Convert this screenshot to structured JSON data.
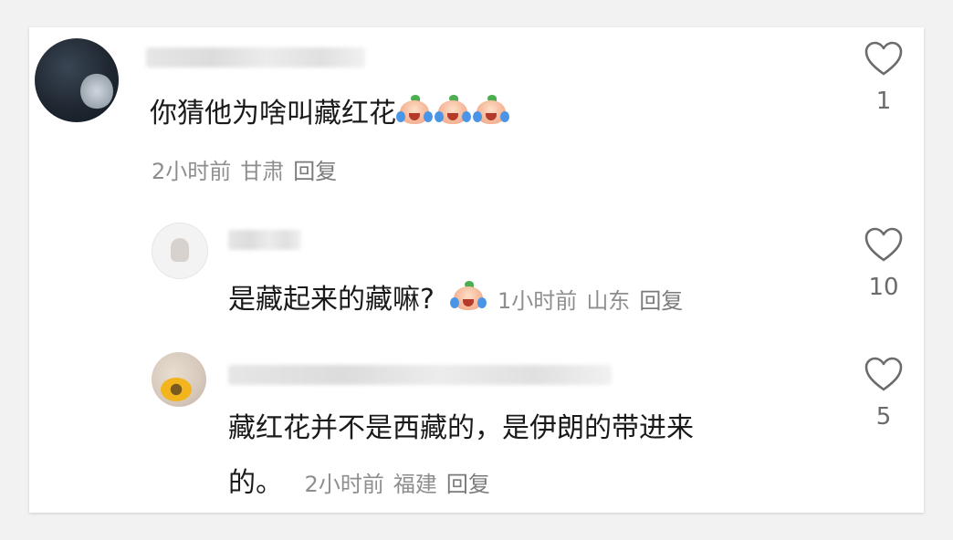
{
  "comments": [
    {
      "text": "你猜他为啥叫藏红花",
      "emoji_icon": "crying-laughing-peach-emoji",
      "meta": {
        "time": "2小时前",
        "location": "甘肃",
        "reply": "回复"
      },
      "likes": "1"
    },
    {
      "text": "是藏起来的藏嘛?",
      "emoji_icon": "crying-laughing-peach-emoji",
      "meta": {
        "time": "1小时前",
        "location": "山东",
        "reply": "回复"
      },
      "likes": "10"
    },
    {
      "text_line1": "藏红花并不是西藏的，是伊朗的带进来",
      "text_line2": "的。",
      "meta": {
        "time": "2小时前",
        "location": "福建",
        "reply": "回复"
      },
      "likes": "5"
    }
  ],
  "icons": {
    "like": "heart-outline-icon"
  },
  "colors": {
    "text": "#1a1a1a",
    "meta": "#8e8e8e",
    "like": "#6b6b6b"
  }
}
